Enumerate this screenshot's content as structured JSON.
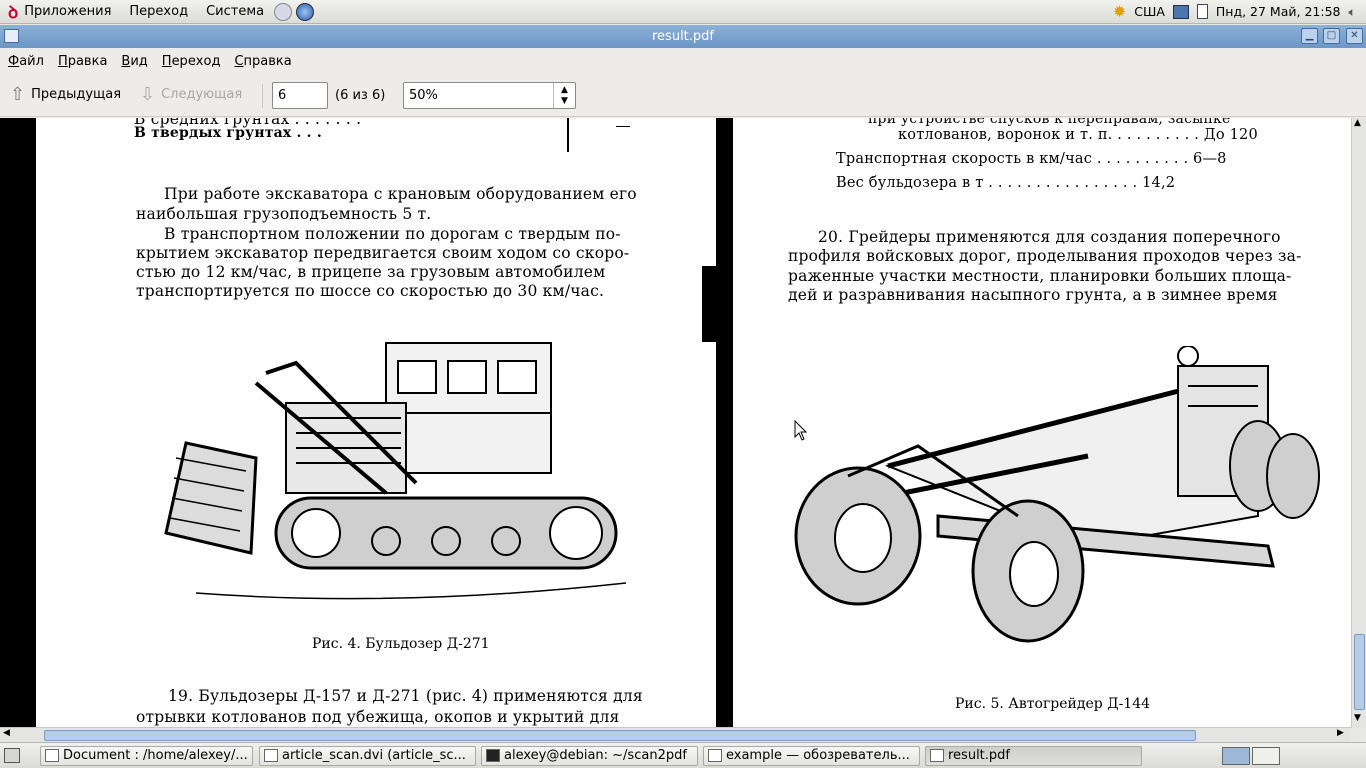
{
  "top_panel": {
    "menus": [
      "Приложения",
      "Переход",
      "Система"
    ],
    "keyboard_layout": "США",
    "clock": "Пнд, 27 Май, 21:58"
  },
  "window": {
    "title": "result.pdf"
  },
  "menubar": [
    "Файл",
    "Правка",
    "Вид",
    "Переход",
    "Справка"
  ],
  "toolbar": {
    "prev_label": "Предыдущая",
    "next_label": "Следующая",
    "page_value": "6",
    "page_of": "(6 из 6)",
    "zoom_value": "50%"
  },
  "left_page": {
    "top_line_1": "В средних грунтах . . . . . . .",
    "top_line_2": "В твердых грунтах . . .",
    "para1": [
      "При работе экскаватора с крановым оборудованием его",
      "наибольшая грузоподъемность 5 т."
    ],
    "para2": [
      "В транспортном положении по дорогам с твердым по-",
      "крытием экскаватор передвигается своим ходом со скоро-",
      "стью до 12 км/час, в прицепе за грузовым автомобилем",
      "транспортируется по шоссе со скоростью до 30 км/час."
    ],
    "figure_caption": "Рис. 4. Бульдозер Д-271",
    "bottom_line_1": "19. Бульдозеры Д-157 и Д-271 (рис. 4) применяются для",
    "bottom_line_2": "отрывки котлованов под убежища, окопов и укрытий для"
  },
  "right_page": {
    "top_line_1": "при устройстве спусков к переправам, засыпке",
    "top_line_2": "котлованов, воронок и т. п. . . . . . . . . . До 120",
    "top_line_3": "Транспортная скорость в км/час . . . . . . . . . . 6—8",
    "top_line_4": "Вес бульдозера в т . . . . . . . . . . . . . . . . 14,2",
    "para": [
      "20. Грейдеры применяются для создания поперечного",
      "профиля войсковых дорог, проделывания проходов через за-",
      "раженные участки местности, планировки больших площа-",
      "дей и разравнивания насыпного грунта, а в зимнее время"
    ],
    "figure_caption": "Рис. 5. Автогрейдер Д-144"
  },
  "taskbar": [
    {
      "label": "Document : /home/alexey/...",
      "active": false
    },
    {
      "label": "article_scan.dvi (article_sc...",
      "active": false
    },
    {
      "label": "alexey@debian: ~/scan2pdf",
      "active": false
    },
    {
      "label": "example — обозреватель...",
      "active": false
    },
    {
      "label": "result.pdf",
      "active": true
    }
  ]
}
